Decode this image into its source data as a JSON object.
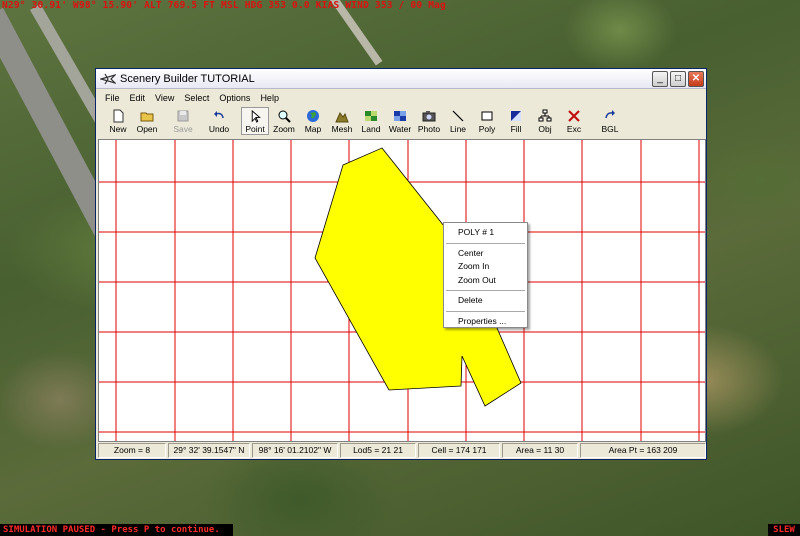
{
  "hud": {
    "text": "N29° 30.91' W98° 15.90' ALT 769.5 FT MSL HDG 353 0.0 KIAS WIND 353 / 00 Mag"
  },
  "status": {
    "paused": "SIMULATION PAUSED - Press P to continue.",
    "mode": "SLEW"
  },
  "window": {
    "title": "Scenery Builder  TUTORIAL",
    "buttons": {
      "minimize": "_",
      "maximize": "□",
      "close": "✕"
    }
  },
  "menu": [
    "File",
    "Edit",
    "View",
    "Select",
    "Options",
    "Help"
  ],
  "toolbar": [
    {
      "label": "New",
      "icon": "new-file-icon"
    },
    {
      "label": "Open",
      "icon": "open-folder-icon"
    },
    {
      "label": "Save",
      "icon": "save-icon",
      "disabled": true
    },
    {
      "label": "Undo",
      "icon": "undo-icon"
    },
    {
      "label": "Point",
      "icon": "pointer-icon",
      "active": true
    },
    {
      "label": "Zoom",
      "icon": "magnifier-icon"
    },
    {
      "label": "Map",
      "icon": "globe-icon"
    },
    {
      "label": "Mesh",
      "icon": "mesh-icon"
    },
    {
      "label": "Land",
      "icon": "land-icon"
    },
    {
      "label": "Water",
      "icon": "water-icon"
    },
    {
      "label": "Photo",
      "icon": "camera-icon"
    },
    {
      "label": "Line",
      "icon": "line-icon"
    },
    {
      "label": "Poly",
      "icon": "poly-icon"
    },
    {
      "label": "Fill",
      "icon": "fill-icon"
    },
    {
      "label": "Obj",
      "icon": "object-icon"
    },
    {
      "label": "Exc",
      "icon": "exclude-icon"
    },
    {
      "label": "BGL",
      "icon": "bgl-icon"
    }
  ],
  "statusbar": [
    "Zoom = 8",
    "29° 32' 39.1547\" N",
    "98° 16' 01.2102\" W",
    "Lod5 = 21 21",
    "Cell = 174 171",
    "Area = 11 30",
    "Area Pt = 163 209"
  ],
  "context_menu": {
    "header": "POLY # 1",
    "group1": [
      "Center",
      "Zoom In",
      "Zoom Out"
    ],
    "group2": [
      "Delete"
    ],
    "group3": [
      "Properties ..."
    ]
  },
  "colors": {
    "grid": "#e00000",
    "polygon_fill": "#ffff00",
    "hud": "#e01010"
  }
}
